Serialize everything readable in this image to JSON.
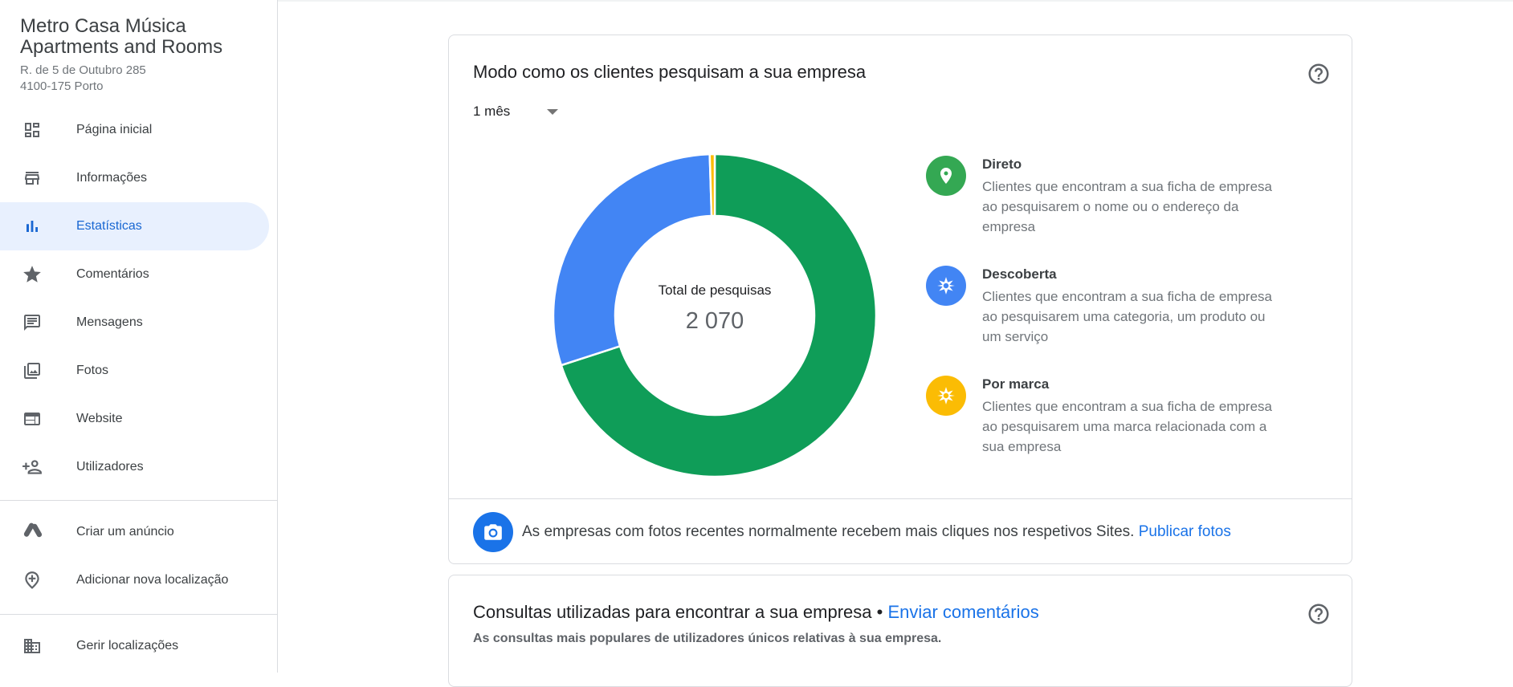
{
  "business": {
    "name_line1": "Metro Casa Música",
    "name_line2": "Apartments and Rooms",
    "address_line1": "R. de 5 de Outubro 285",
    "address_line2": "4100-175 Porto"
  },
  "sidebar": {
    "items": [
      {
        "label": "Página inicial",
        "icon": "dashboard-icon"
      },
      {
        "label": "Informações",
        "icon": "storefront-icon"
      },
      {
        "label": "Estatísticas",
        "icon": "bar-chart-icon",
        "active": true
      },
      {
        "label": "Comentários",
        "icon": "star-icon"
      },
      {
        "label": "Mensagens",
        "icon": "message-icon"
      },
      {
        "label": "Fotos",
        "icon": "photos-icon"
      },
      {
        "label": "Website",
        "icon": "web-icon"
      },
      {
        "label": "Utilizadores",
        "icon": "add-person-icon"
      }
    ],
    "secondary": [
      {
        "label": "Criar um anúncio",
        "icon": "google-ads-icon"
      },
      {
        "label": "Adicionar nova localização",
        "icon": "add-location-icon"
      }
    ],
    "tertiary": [
      {
        "label": "Gerir localizações",
        "icon": "building-icon"
      }
    ]
  },
  "search_card": {
    "title": "Modo como os clientes pesquisam a sua empresa",
    "period": "1 mês",
    "total_label": "Total de pesquisas",
    "total_value": "2 070",
    "legend": [
      {
        "name": "Direto",
        "description": "Clientes que encontram a sua ficha de empresa ao pesquisarem o nome ou o endereço da empresa",
        "color": "#34a853",
        "icon": "location-pin-icon"
      },
      {
        "name": "Descoberta",
        "description": "Clientes que encontram a sua ficha de empresa ao pesquisarem uma categoria, um produto ou um serviço",
        "color": "#4285f4",
        "icon": "compass-icon"
      },
      {
        "name": "Por marca",
        "description": "Clientes que encontram a sua ficha de empresa ao pesquisarem uma marca relacionada com a sua empresa",
        "color": "#fbbc04",
        "icon": "compass-icon"
      }
    ],
    "tip_text": "As empresas com fotos recentes normalmente recebem mais cliques nos respetivos Sites.",
    "tip_link": "Publicar fotos"
  },
  "queries_card": {
    "title": "Consultas utilizadas para encontrar a sua empresa",
    "separator": " • ",
    "link": "Enviar comentários",
    "subtitle": "As consultas mais populares de utilizadores únicos relativas à sua empresa."
  },
  "chart_data": {
    "type": "pie",
    "categories": [
      "Direto",
      "Descoberta",
      "Por marca"
    ],
    "values": [
      0.7,
      0.295,
      0.005
    ],
    "colors": [
      "#0f9d58",
      "#4285f4",
      "#fbbc04"
    ],
    "total": 2070
  }
}
